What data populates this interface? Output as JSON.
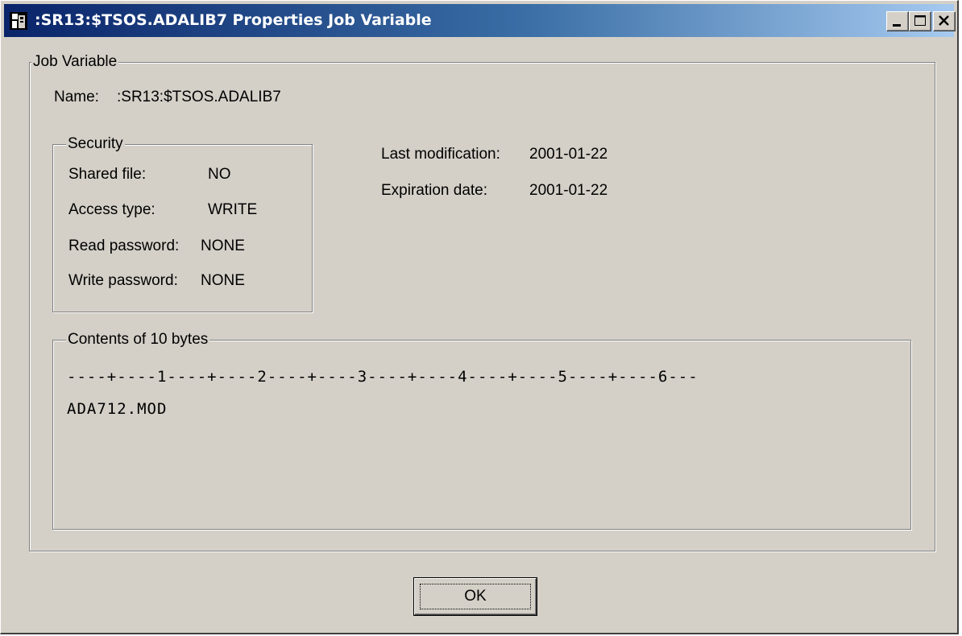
{
  "window": {
    "title": ":SR13:$TSOS.ADALIB7 Properties Job Variable",
    "icon": "job-variable-icon",
    "title_gradient": [
      "#0a246a",
      "#a6caf0"
    ],
    "face_color": "#d4d0c8"
  },
  "job_variable": {
    "group_label": "Job Variable",
    "name_label": "Name:",
    "name_value": ":SR13:$TSOS.ADALIB7"
  },
  "security": {
    "group_label": "Security",
    "shared_file_label": "Shared file:",
    "shared_file_value": "NO",
    "access_type_label": "Access type:",
    "access_type_value": "WRITE",
    "read_password_label": "Read password:",
    "read_password_value": "NONE",
    "write_password_label": "Write password:",
    "write_password_value": "NONE"
  },
  "dates": {
    "last_modification_label": "Last modification:",
    "last_modification_value": "2001-01-22",
    "expiration_label": "Expiration date:",
    "expiration_value": "2001-01-22"
  },
  "contents": {
    "group_label": "Contents of 10 bytes",
    "ruler": "----+----1----+----2----+----3----+----4----+----5----+----6---",
    "text": "ADA712.MOD"
  },
  "buttons": {
    "ok_label": "OK"
  }
}
